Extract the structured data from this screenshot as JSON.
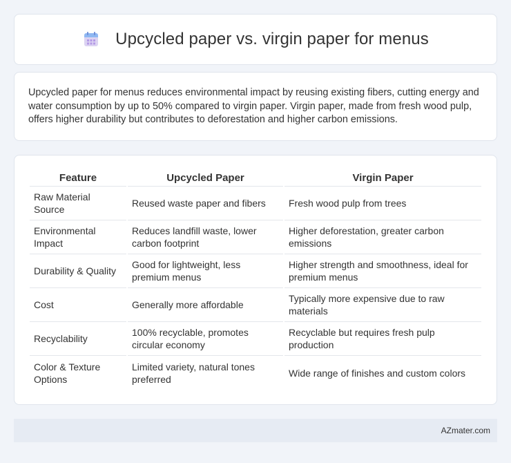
{
  "header": {
    "title": "Upcycled paper vs. virgin paper for menus",
    "icon": "calendar-icon"
  },
  "summary": {
    "text": "Upcycled paper for menus reduces environmental impact by reusing existing fibers, cutting energy and water consumption by up to 50% compared to virgin paper. Virgin paper, made from fresh wood pulp, offers higher durability but contributes to deforestation and higher carbon emissions."
  },
  "table": {
    "headers": [
      "Feature",
      "Upcycled Paper",
      "Virgin Paper"
    ],
    "rows": [
      [
        "Raw Material Source",
        "Reused waste paper and fibers",
        "Fresh wood pulp from trees"
      ],
      [
        "Environmental Impact",
        "Reduces landfill waste, lower carbon footprint",
        "Higher deforestation, greater carbon emissions"
      ],
      [
        "Durability & Quality",
        "Good for lightweight, less premium menus",
        "Higher strength and smoothness, ideal for premium menus"
      ],
      [
        "Cost",
        "Generally more affordable",
        "Typically more expensive due to raw materials"
      ],
      [
        "Recyclability",
        "100% recyclable, promotes circular economy",
        "Recyclable but requires fresh pulp production"
      ],
      [
        "Color & Texture Options",
        "Limited variety, natural tones preferred",
        "Wide range of finishes and custom colors"
      ]
    ]
  },
  "footer": {
    "brand": "AZmater.com"
  }
}
